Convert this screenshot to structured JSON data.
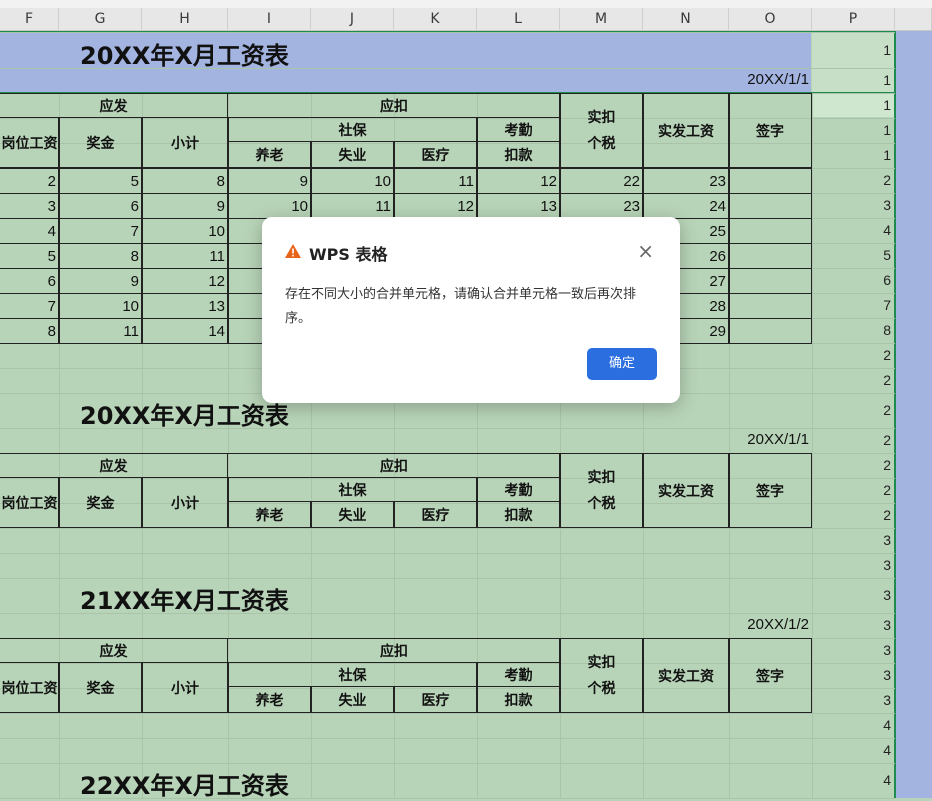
{
  "columns": [
    "F",
    "G",
    "H",
    "I",
    "J",
    "K",
    "L",
    "M",
    "N",
    "O",
    "P"
  ],
  "titles": [
    "20XX年X月工资表",
    "20XX年X月工资表",
    "21XX年X月工资表",
    "22XX年X月工资表"
  ],
  "dates": [
    "20XX/1/1",
    "20XX/1/1",
    "20XX/1/2"
  ],
  "headers": {
    "yingfa": "应发",
    "yingkou": "应扣",
    "gangwei": "岗位工资",
    "jiangjin": "奖金",
    "xiaoji": "小计",
    "shebao": "社保",
    "kaoqin": "考勤",
    "kaoqin2": "扣款",
    "yanglao": "养老",
    "shiye": "失业",
    "yiliao": "医疗",
    "shikou": "实扣",
    "geshui": "个税",
    "shifa": "实发工资",
    "qianzi": "签字"
  },
  "table1": {
    "rows": [
      [
        2,
        5,
        8,
        9,
        10,
        11,
        12,
        22,
        23
      ],
      [
        3,
        6,
        9,
        10,
        11,
        12,
        13,
        23,
        24
      ],
      [
        4,
        7,
        10,
        "",
        "",
        "",
        "",
        "",
        25
      ],
      [
        5,
        8,
        11,
        "",
        "",
        "",
        "",
        "",
        26
      ],
      [
        6,
        9,
        12,
        "",
        "",
        "",
        "",
        "",
        27
      ],
      [
        7,
        10,
        13,
        "",
        "",
        "",
        "",
        "",
        28
      ],
      [
        8,
        11,
        14,
        "",
        "",
        "",
        "",
        "",
        29
      ]
    ]
  },
  "row_numbers": [
    "1",
    "1",
    "1",
    "1",
    "1",
    "2",
    "3",
    "4",
    "5",
    "6",
    "7",
    "8",
    "2",
    "2",
    "2",
    "2",
    "2",
    "2",
    "2",
    "3",
    "3",
    "3",
    "3",
    "3",
    "3",
    "3",
    "4",
    "4",
    "4"
  ],
  "dialog": {
    "title": "WPS 表格",
    "message": "存在不同大小的合并单元格，请确认合并单元格一致后再次排序。",
    "ok_label": "确定",
    "close_glyph": "×"
  },
  "colors": {
    "sheet_bg": "#b8d4b8",
    "header_row_bg": "#a3b4e0",
    "accent_button": "#2a6ee0",
    "warning": "#e8631a"
  }
}
